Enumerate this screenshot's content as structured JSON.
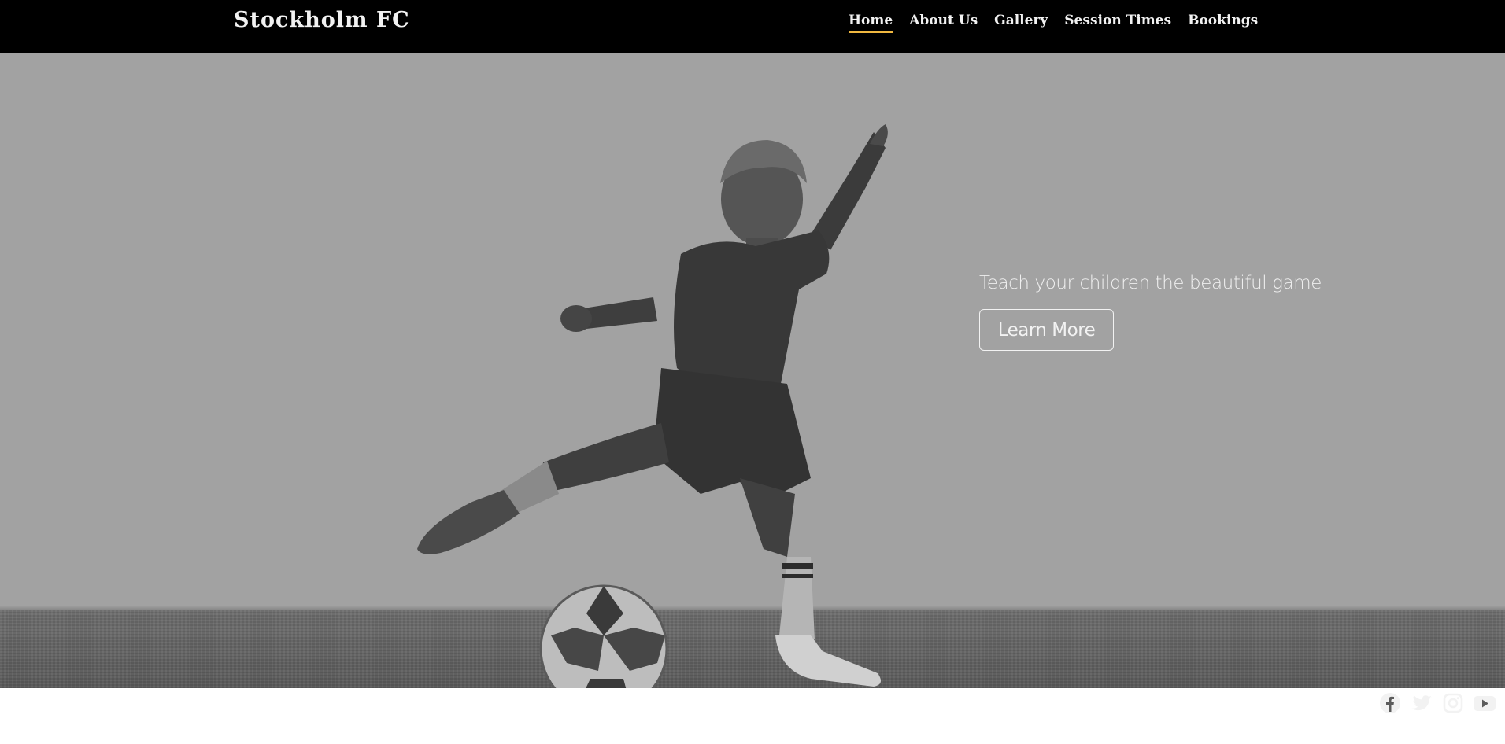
{
  "header": {
    "brand": "Stockholm FC",
    "nav": [
      {
        "label": "Home",
        "active": true
      },
      {
        "label": "About Us"
      },
      {
        "label": "Gallery"
      },
      {
        "label": "Session Times"
      },
      {
        "label": "Bookings"
      }
    ]
  },
  "hero": {
    "tagline": "Teach your children the beautiful game",
    "button_label": "Learn More",
    "image_subject": "boy kicking soccer ball on grass"
  },
  "socials": [
    {
      "icon": "facebook-icon"
    },
    {
      "icon": "twitter-icon"
    },
    {
      "icon": "instagram-icon"
    },
    {
      "icon": "youtube-icon"
    }
  ],
  "colors": {
    "navbar_bg": "#000000",
    "hero_bg": "#a2a2a2",
    "nav_active_underline": "#f0b840",
    "text_light": "#f2f2f2"
  }
}
